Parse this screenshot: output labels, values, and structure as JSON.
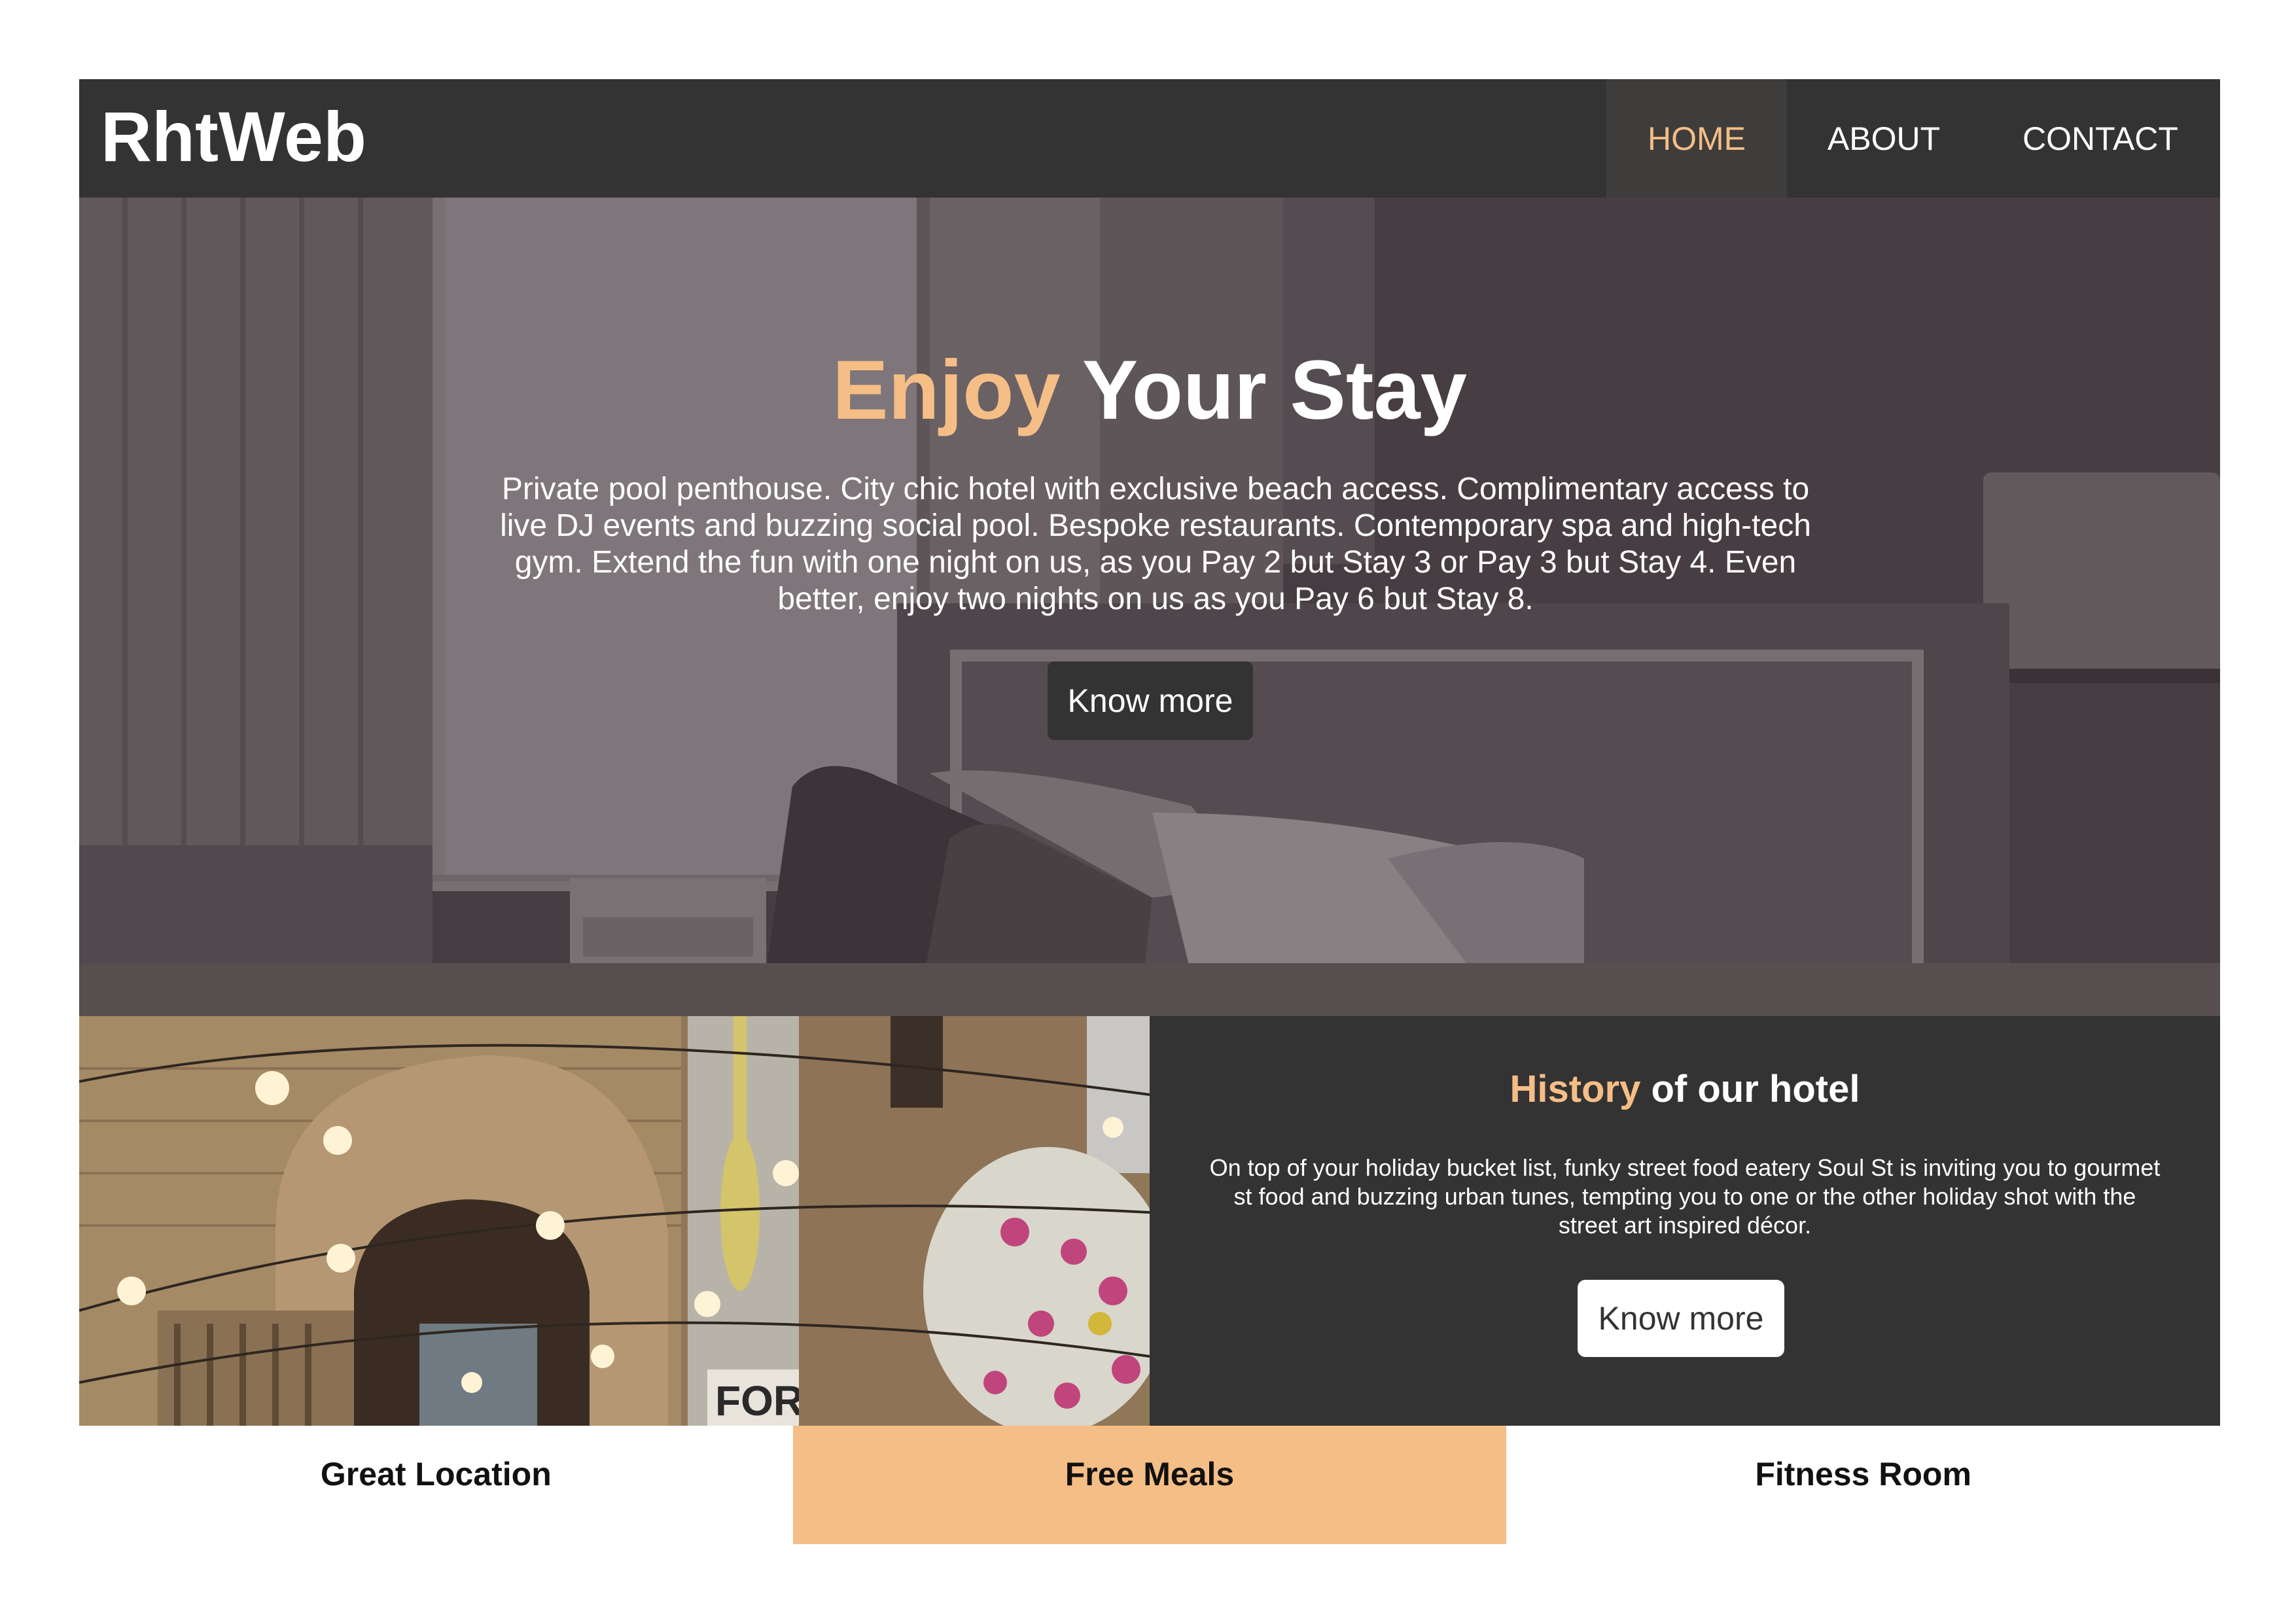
{
  "brand": {
    "logo": "RhtWeb"
  },
  "nav": {
    "items": [
      {
        "label": "HOME",
        "active": true
      },
      {
        "label": "ABOUT",
        "active": false
      },
      {
        "label": "CONTACT",
        "active": false
      }
    ]
  },
  "hero": {
    "title_accent": "Enjoy",
    "title_rest": "Your Stay",
    "text": "Private pool penthouse. City chic hotel with exclusive beach access. Complimentary access to live DJ events and buzzing social pool. Bespoke restaurants. Contemporary spa and high-tech gym. Extend the fun with one night on us, as you Pay 2 but Stay 3 or Pay 3 but Stay 4. Even better, enjoy two nights on us as you Pay 6 but Stay 8.",
    "button_label": "Know more"
  },
  "history": {
    "title_accent": "History",
    "title_rest": "of our hotel",
    "text": "On top of your holiday bucket list, funky street food eatery Soul St is inviting you to gourmet st food and buzzing urban tunes, tempting you to one or the other holiday shot with the street art inspired décor.",
    "button_label": "Know more"
  },
  "street_photo": {
    "sign_text": "FORK"
  },
  "features": [
    {
      "label": "Great Location",
      "active": false
    },
    {
      "label": "Free Meals",
      "active": true
    },
    {
      "label": "Fitness Room",
      "active": false
    }
  ],
  "colors": {
    "accent": "#f5be86",
    "dark": "#333333",
    "hero_overlay": "#4b4247"
  }
}
